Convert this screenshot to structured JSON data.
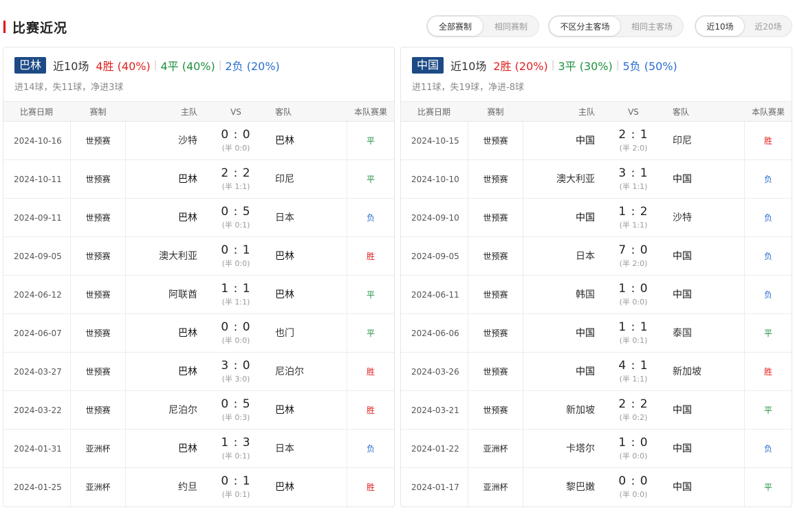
{
  "header": {
    "title": "比赛近况",
    "filters": [
      {
        "options": [
          "全部赛制",
          "相同赛制"
        ],
        "active": 0
      },
      {
        "options": [
          "不区分主客场",
          "相同主客场"
        ],
        "active": 0
      },
      {
        "options": [
          "近10场",
          "近20场"
        ],
        "active": 0
      }
    ]
  },
  "colors": {
    "accent": "#e60012",
    "badge": "#1d4a85",
    "win": "#e21f1f",
    "draw": "#1e8f3e",
    "loss": "#2a6fcf"
  },
  "columns": [
    "比赛日期",
    "赛制",
    "主队",
    "VS",
    "客队",
    "本队赛果"
  ],
  "panels": [
    {
      "team": "巴林",
      "recent_label": "近10场",
      "wins": "4胜 (40%)",
      "draws": "4平 (40%)",
      "losses": "2负 (20%)",
      "summary": "进14球，失11球，净进3球",
      "matches": [
        {
          "date": "2024-10-16",
          "comp": "世预赛",
          "home": "沙特",
          "score": "0 : 0",
          "half": "(半 0:0)",
          "away": "巴林",
          "result": "平",
          "home_bold": false,
          "away_bold": true
        },
        {
          "date": "2024-10-11",
          "comp": "世预赛",
          "home": "巴林",
          "score": "2 : 2",
          "half": "(半 1:1)",
          "away": "印尼",
          "result": "平",
          "home_bold": true,
          "away_bold": false
        },
        {
          "date": "2024-09-11",
          "comp": "世预赛",
          "home": "巴林",
          "score": "0 : 5",
          "half": "(半 0:1)",
          "away": "日本",
          "result": "负",
          "home_bold": true,
          "away_bold": false
        },
        {
          "date": "2024-09-05",
          "comp": "世预赛",
          "home": "澳大利亚",
          "score": "0 : 1",
          "half": "(半 0:0)",
          "away": "巴林",
          "result": "胜",
          "home_bold": false,
          "away_bold": true
        },
        {
          "date": "2024-06-12",
          "comp": "世预赛",
          "home": "阿联酋",
          "score": "1 : 1",
          "half": "(半 1:1)",
          "away": "巴林",
          "result": "平",
          "home_bold": false,
          "away_bold": true
        },
        {
          "date": "2024-06-07",
          "comp": "世预赛",
          "home": "巴林",
          "score": "0 : 0",
          "half": "(半 0:0)",
          "away": "也门",
          "result": "平",
          "home_bold": true,
          "away_bold": false
        },
        {
          "date": "2024-03-27",
          "comp": "世预赛",
          "home": "巴林",
          "score": "3 : 0",
          "half": "(半 3:0)",
          "away": "尼泊尔",
          "result": "胜",
          "home_bold": true,
          "away_bold": false
        },
        {
          "date": "2024-03-22",
          "comp": "世预赛",
          "home": "尼泊尔",
          "score": "0 : 5",
          "half": "(半 0:3)",
          "away": "巴林",
          "result": "胜",
          "home_bold": false,
          "away_bold": true
        },
        {
          "date": "2024-01-31",
          "comp": "亚洲杯",
          "home": "巴林",
          "score": "1 : 3",
          "half": "(半 0:1)",
          "away": "日本",
          "result": "负",
          "home_bold": true,
          "away_bold": false
        },
        {
          "date": "2024-01-25",
          "comp": "亚洲杯",
          "home": "约旦",
          "score": "0 : 1",
          "half": "(半 0:1)",
          "away": "巴林",
          "result": "胜",
          "home_bold": false,
          "away_bold": true
        }
      ]
    },
    {
      "team": "中国",
      "recent_label": "近10场",
      "wins": "2胜 (20%)",
      "draws": "3平 (30%)",
      "losses": "5负 (50%)",
      "summary": "进11球，失19球，净进-8球",
      "matches": [
        {
          "date": "2024-10-15",
          "comp": "世预赛",
          "home": "中国",
          "score": "2 : 1",
          "half": "(半 2:0)",
          "away": "印尼",
          "result": "胜",
          "home_bold": true,
          "away_bold": false
        },
        {
          "date": "2024-10-10",
          "comp": "世预赛",
          "home": "澳大利亚",
          "score": "3 : 1",
          "half": "(半 1:1)",
          "away": "中国",
          "result": "负",
          "home_bold": false,
          "away_bold": true
        },
        {
          "date": "2024-09-10",
          "comp": "世预赛",
          "home": "中国",
          "score": "1 : 2",
          "half": "(半 1:1)",
          "away": "沙特",
          "result": "负",
          "home_bold": true,
          "away_bold": false
        },
        {
          "date": "2024-09-05",
          "comp": "世预赛",
          "home": "日本",
          "score": "7 : 0",
          "half": "(半 2:0)",
          "away": "中国",
          "result": "负",
          "home_bold": false,
          "away_bold": true
        },
        {
          "date": "2024-06-11",
          "comp": "世预赛",
          "home": "韩国",
          "score": "1 : 0",
          "half": "(半 0:0)",
          "away": "中国",
          "result": "负",
          "home_bold": false,
          "away_bold": true
        },
        {
          "date": "2024-06-06",
          "comp": "世预赛",
          "home": "中国",
          "score": "1 : 1",
          "half": "(半 0:1)",
          "away": "泰国",
          "result": "平",
          "home_bold": true,
          "away_bold": false
        },
        {
          "date": "2024-03-26",
          "comp": "世预赛",
          "home": "中国",
          "score": "4 : 1",
          "half": "(半 1:1)",
          "away": "新加坡",
          "result": "胜",
          "home_bold": true,
          "away_bold": false
        },
        {
          "date": "2024-03-21",
          "comp": "世预赛",
          "home": "新加坡",
          "score": "2 : 2",
          "half": "(半 0:2)",
          "away": "中国",
          "result": "平",
          "home_bold": false,
          "away_bold": true
        },
        {
          "date": "2024-01-22",
          "comp": "亚洲杯",
          "home": "卡塔尔",
          "score": "1 : 0",
          "half": "(半 0:0)",
          "away": "中国",
          "result": "负",
          "home_bold": false,
          "away_bold": true
        },
        {
          "date": "2024-01-17",
          "comp": "亚洲杯",
          "home": "黎巴嫩",
          "score": "0 : 0",
          "half": "(半 0:0)",
          "away": "中国",
          "result": "平",
          "home_bold": false,
          "away_bold": true
        }
      ]
    }
  ]
}
